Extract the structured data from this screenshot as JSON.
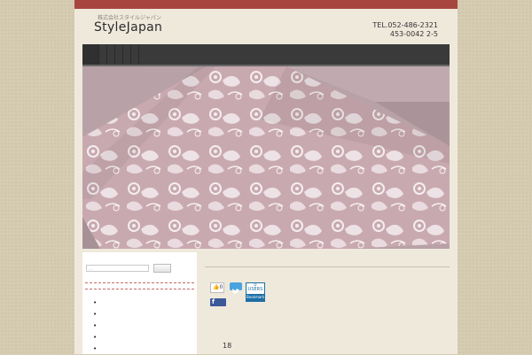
{
  "header": {
    "company_name": "株式会社スタイルジャパン",
    "site_title": "StyleJapan",
    "tel_line": "TEL.052-486-2321",
    "address_line": "453-0042 2-5"
  },
  "nav": {
    "items": []
  },
  "hero": {
    "image": "pink-lace-floral-fabric"
  },
  "sidebar": {
    "search": {
      "placeholder": "...",
      "button_label": ""
    },
    "list_items": [
      "",
      "",
      "",
      "",
      ""
    ]
  },
  "main": {
    "social": {
      "like_count": "0",
      "twitter_label": "",
      "facebook_label": "f",
      "hatena_count": "0",
      "hatena_label": "USERS",
      "hatena_caption": "Bookmark"
    },
    "page_number": "18"
  },
  "colors": {
    "accent_topbar": "#a8453f",
    "nav_bg": "#3a3a3a",
    "background": "#d6ccb2",
    "panel": "#efe9dc",
    "hero_pink": "#c4a3aa"
  }
}
